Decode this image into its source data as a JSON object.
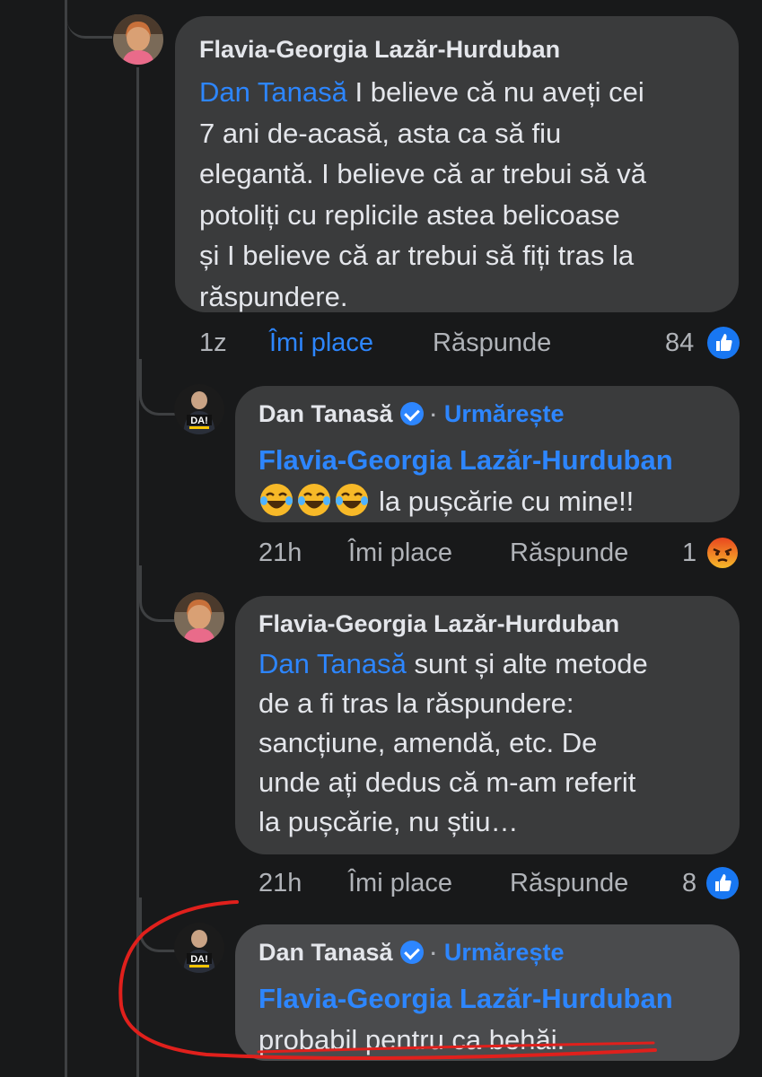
{
  "comments": [
    {
      "author": "Flavia-Georgia Lazăr-Hurduban",
      "mention": "Dan Tanasă",
      "text_lines": [
        " I believe că nu aveți cei",
        "7 ani de-acasă, asta ca să fiu",
        "elegantă. I believe că ar trebui să vă",
        "potoliți cu replicile astea belicoase",
        "și I believe că ar trebui să fiți tras la",
        "răspundere."
      ],
      "time": "1z",
      "like": "Îmi place",
      "reply": "Răspunde",
      "reaction_count": "84",
      "reaction_icon": "like-reaction-icon"
    },
    {
      "author": "Dan Tanasă",
      "follow": "Urmărește",
      "mention": "Flavia-Georgia Lazăr-Hurduban",
      "text": "la pușcărie cu mine!!",
      "time": "21h",
      "like": "Îmi place",
      "reply": "Răspunde",
      "reaction_count": "1",
      "reaction_icon": "angry-reaction-icon"
    },
    {
      "author": "Flavia-Georgia Lazăr-Hurduban",
      "mention": "Dan Tanasă",
      "text_lines": [
        " sunt și alte metode",
        "de a fi tras la răspundere:",
        "sancțiune, amendă, etc. De",
        "unde ați dedus că m-am referit",
        "la pușcărie, nu știu…"
      ],
      "time": "21h",
      "like": "Îmi place",
      "reply": "Răspunde",
      "reaction_count": "8",
      "reaction_icon": "like-reaction-icon"
    },
    {
      "author": "Dan Tanasă",
      "follow": "Urmărește",
      "mention": "Flavia-Georgia Lazăr-Hurduban",
      "text": "probabil pentru ca behăi."
    }
  ],
  "avatar_badge": "DA!",
  "colors": {
    "background": "#18191a",
    "bubble": "#3a3b3c",
    "link": "#2d86ff",
    "muted": "#b0b3b8",
    "annotation": "#e0201c"
  }
}
